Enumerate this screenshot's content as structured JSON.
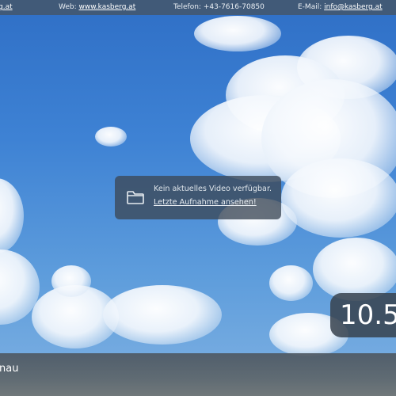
{
  "topbar": {
    "email_prefix_partial": "g.at",
    "web_label": "Web:",
    "web_link": "www.kasberg.at",
    "phone_label": "Telefon:",
    "phone_value": "+43-7616-70850",
    "email_label": "E-Mail:",
    "email_link": "info@kasberg.at"
  },
  "message": {
    "icon": "folder-icon",
    "line1": "Kein aktuelles Video verfügbar.",
    "line2_link": "Letzte Aufnahme ansehen!"
  },
  "temperature": {
    "value": "10.5"
  },
  "location": {
    "name_partial": "renau"
  }
}
